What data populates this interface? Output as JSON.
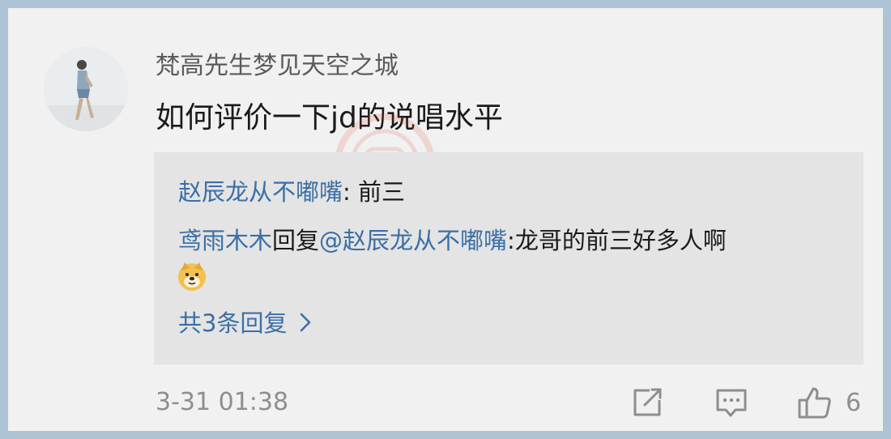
{
  "comment": {
    "username": "梵高先生梦见天空之城",
    "text": "如何评价一下jd的说唱水平",
    "timestamp": "3-31 01:38",
    "like_count": "6"
  },
  "replies": [
    {
      "author": "赵辰龙从不嘟嘴",
      "separator": ": ",
      "text": "前三"
    },
    {
      "author": "鸢雨木木",
      "reply_word": "回复",
      "mention": "@赵辰龙从不嘟嘴",
      "separator": ":",
      "text": "龙哥的前三好多人啊"
    }
  ],
  "more_replies_label": "共3条回复",
  "icons": {
    "share": "share-icon",
    "comment": "comment-icon",
    "like": "thumbs-up-icon",
    "emoji": "doge-emoji",
    "chevron": "chevron-right-icon"
  },
  "colors": {
    "link": "#3a6fa6",
    "border": "#aec3d6",
    "background": "#f1f1f1",
    "reply_background": "#e4e4e4"
  }
}
